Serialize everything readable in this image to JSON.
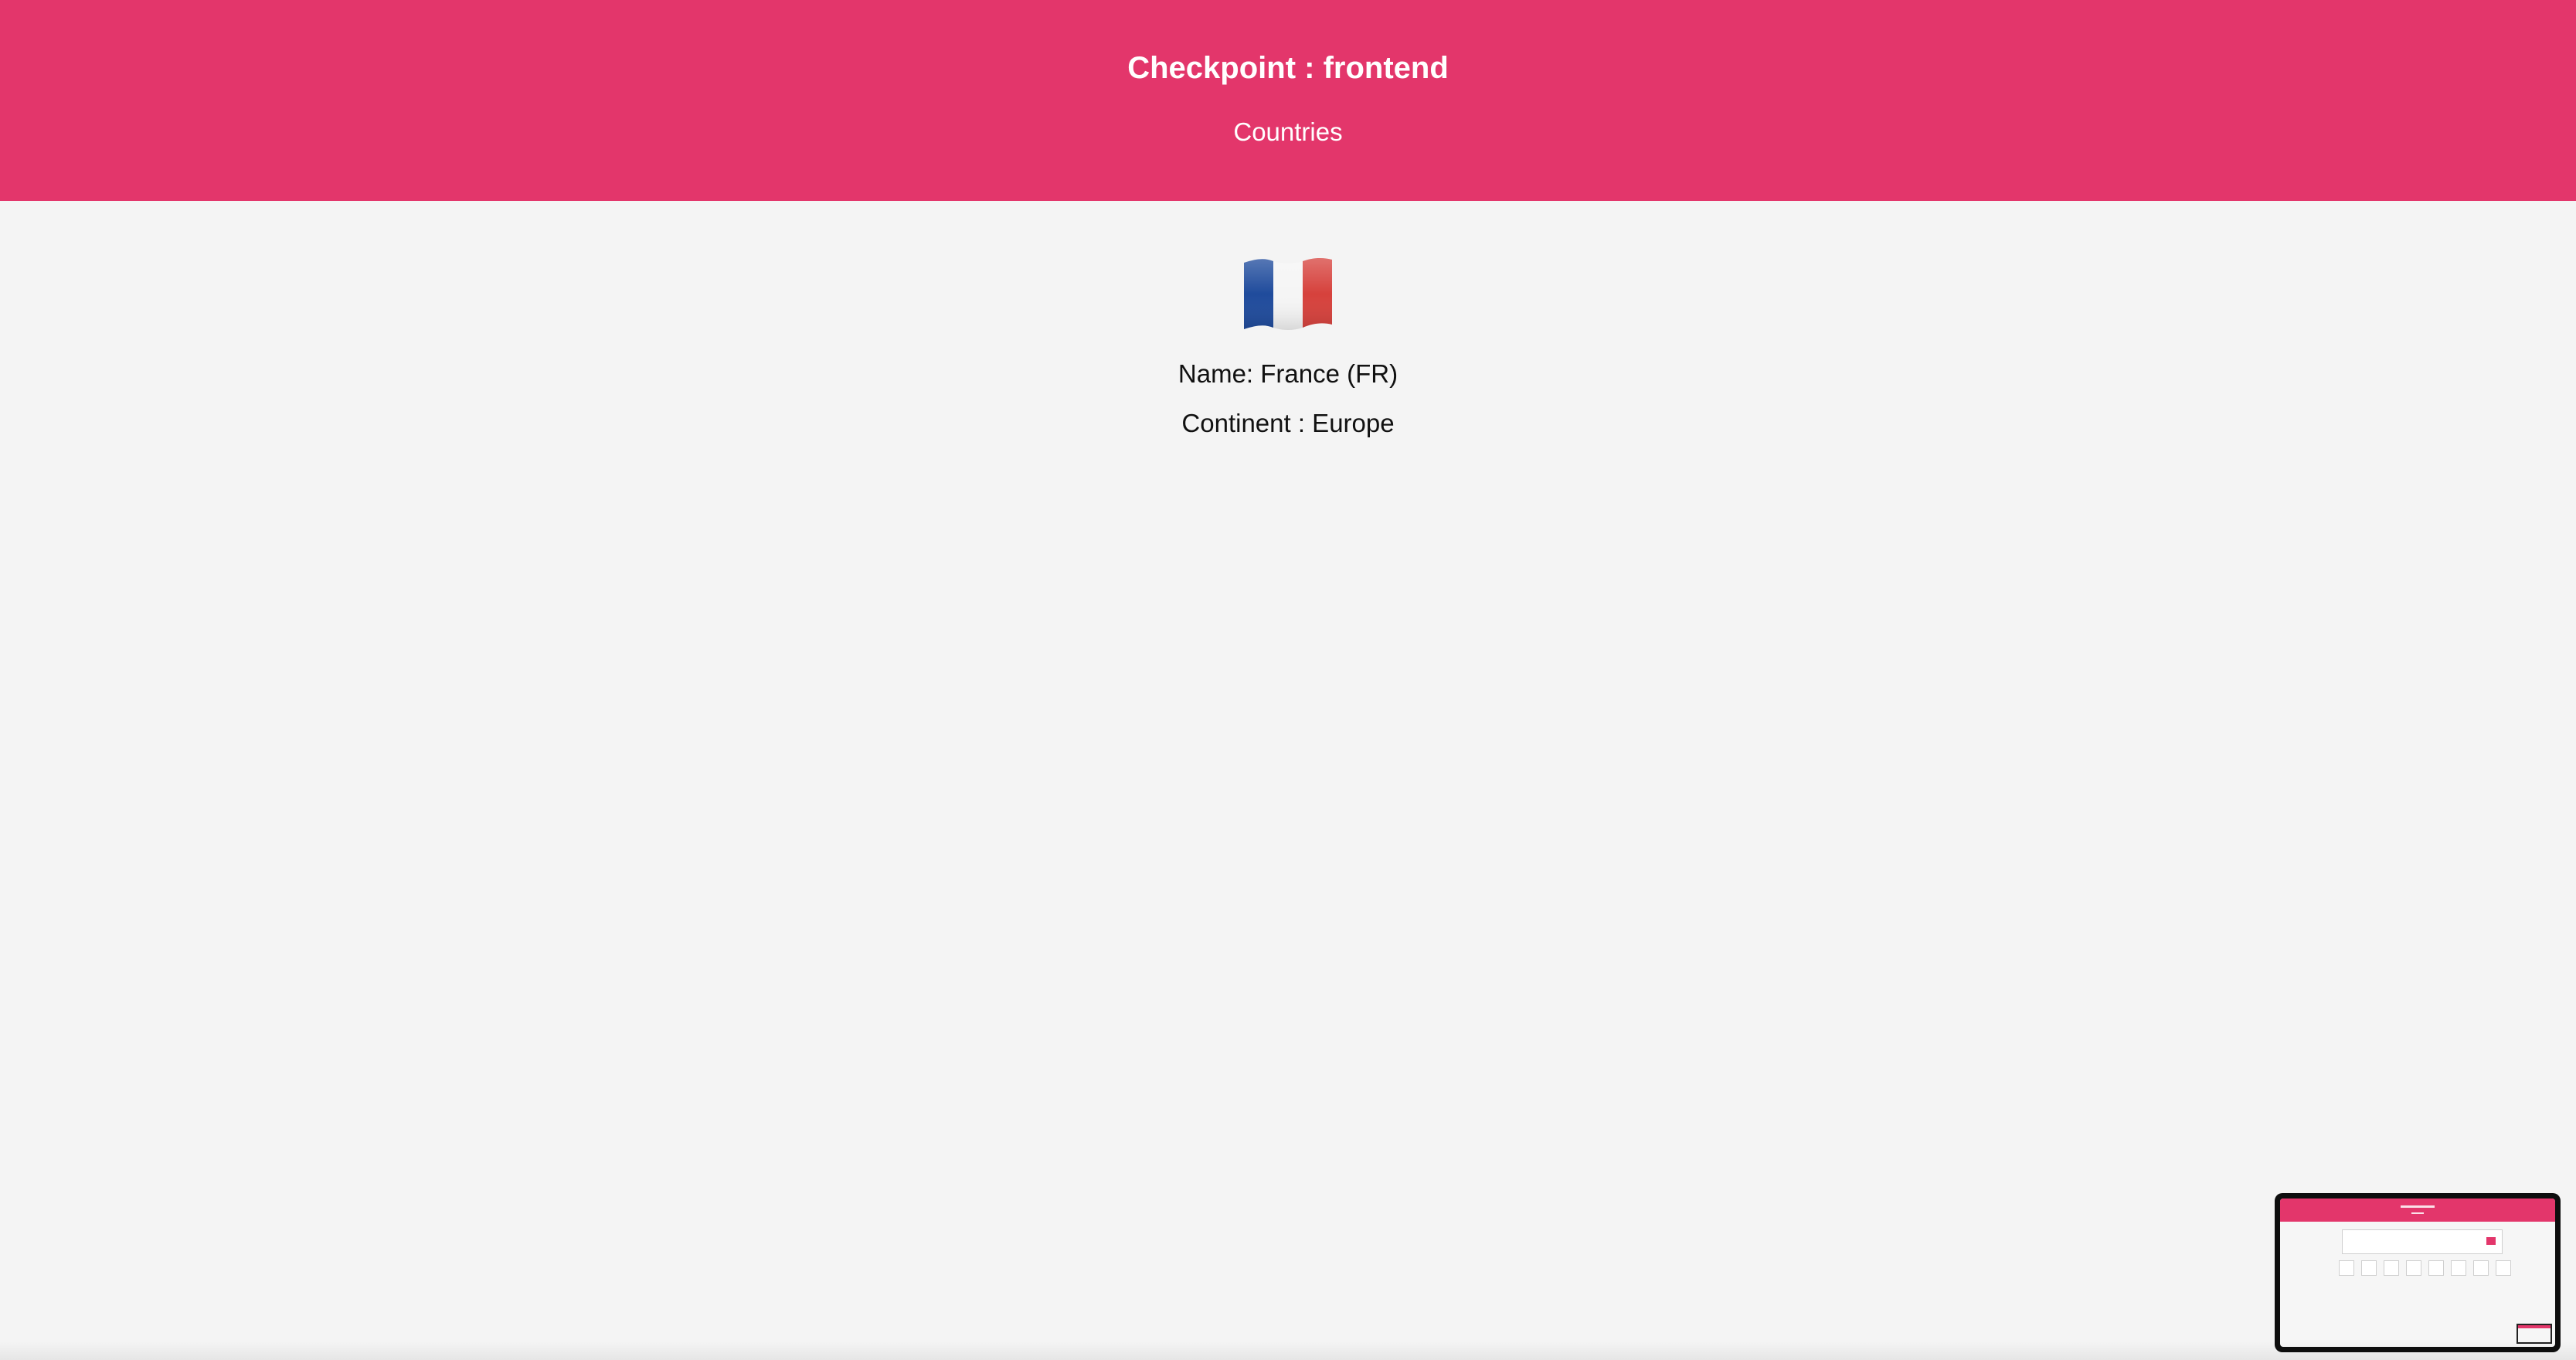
{
  "header": {
    "title": "Checkpoint : frontend",
    "link_label": "Countries",
    "background_color": "#e3366b"
  },
  "country": {
    "flag_icon": "france-flag-icon",
    "name_line": "Name: France (FR)",
    "continent_line": "Continent : Europe"
  },
  "preview": {
    "description_icon": "app-preview-thumbnail"
  }
}
